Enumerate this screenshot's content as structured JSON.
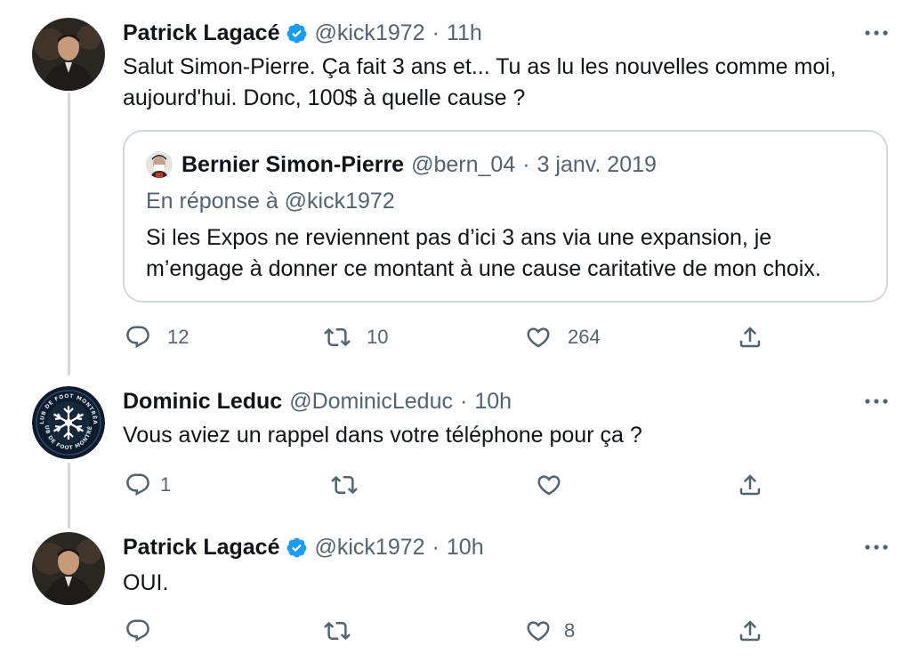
{
  "tweets": [
    {
      "name": "Patrick Lagacé",
      "verified": true,
      "handle": "@kick1972",
      "time": "11h",
      "separator": "·",
      "text_line1": "Salut Simon-Pierre. Ça fait 3 ans et... Tu as lu les nouvelles comme moi,",
      "text_line2": "aujourd'hui. Donc, 100$ à quelle cause ?",
      "quote": {
        "name": "Bernier Simon-Pierre",
        "handle": "@bern_04",
        "date": "3 janv. 2019",
        "separator": "·",
        "reply_to": "En réponse à @kick1972",
        "text_line1": "Si les Expos ne reviennent pas d’ici 3 ans via une expansion, je",
        "text_line2": "m’engage à donner ce montant à une cause caritative de mon choix."
      },
      "replies": "12",
      "retweets": "10",
      "likes": "264"
    },
    {
      "name": "Dominic Leduc",
      "verified": false,
      "handle": "@DominicLeduc",
      "time": "10h",
      "separator": "·",
      "text_line1": "Vous aviez un rappel dans votre téléphone pour ça ?",
      "avatar_ring_text": "CLUB DE FOOT MONTRÉAL",
      "replies": "1",
      "retweets": "",
      "likes": ""
    },
    {
      "name": "Patrick Lagacé",
      "verified": true,
      "handle": "@kick1972",
      "time": "10h",
      "separator": "·",
      "text_line1": "OUI.",
      "replies": "",
      "retweets": "",
      "likes": "8"
    }
  ],
  "icons": {
    "reply": "reply-icon",
    "retweet": "retweet-icon",
    "like": "heart-icon",
    "share": "share-icon",
    "more": "more-icon",
    "verified": "verified-badge-icon"
  },
  "colors": {
    "verified": "#1d9bf0",
    "secondary_text": "#536471",
    "border": "#cfd9de"
  }
}
